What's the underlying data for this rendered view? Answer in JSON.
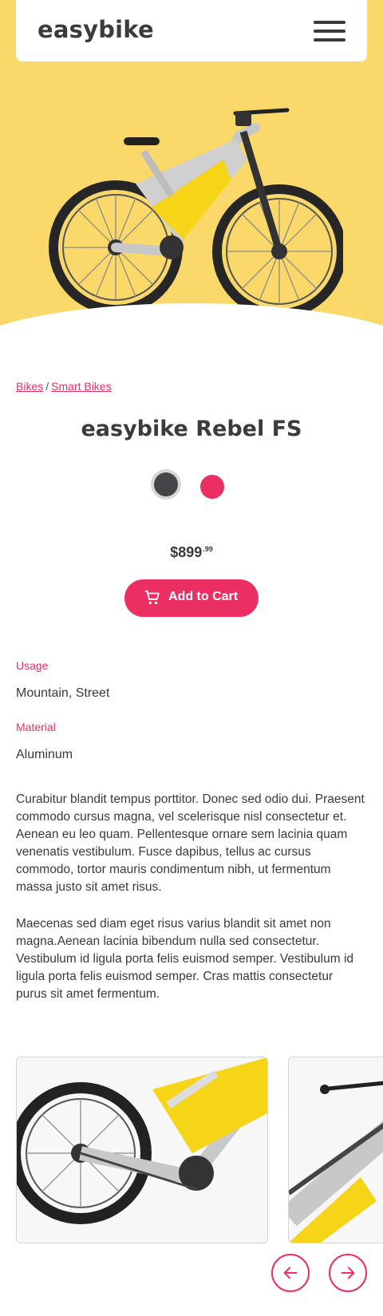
{
  "header": {
    "logo": "easybike",
    "menu_icon": "hamburger-menu-icon"
  },
  "hero": {
    "image": "electric mountain bike",
    "background_color": "#fad96a"
  },
  "breadcrumb": {
    "items": [
      "Bikes",
      "Smart Bikes"
    ],
    "separator": "/"
  },
  "product": {
    "title": "easybike Rebel FS",
    "colors": [
      {
        "name": "dark-gray",
        "hex": "#444449",
        "selected": true
      },
      {
        "name": "pink",
        "hex": "#ec2f62",
        "selected": false
      }
    ],
    "price_main": "$899",
    "price_cents": ".99",
    "add_to_cart": "Add to Cart",
    "cart_icon": "shopping-cart-icon"
  },
  "specs": [
    {
      "label": "Usage",
      "value": "Mountain, Street"
    },
    {
      "label": "Material",
      "value": "Aluminum"
    }
  ],
  "description": [
    "Curabitur blandit tempus porttitor. Donec sed odio dui. Praesent commodo cursus magna, vel scelerisque nisl consectetur et. Aenean eu leo quam. Pellentesque ornare sem lacinia quam venenatis vestibulum. Fusce dapibus, tellus ac cursus commodo, tortor mauris condimentum nibh, ut fermentum massa justo sit amet risus.",
    "Maecenas sed diam eget risus varius blandit sit amet non magna.Aenean lacinia bibendum nulla sed consectetur. Vestibulum id ligula porta felis euismod semper. Vestibulum id ligula porta felis euismod semper. Cras mattis consectetur purus sit amet fermentum."
  ],
  "gallery": {
    "images": [
      "bike rear wheel detail",
      "bike handlebar detail"
    ],
    "prev_icon": "arrow-left-icon",
    "next_icon": "arrow-right-icon"
  },
  "theme": {
    "accent": "#ec2f62",
    "text": "#3a3a3a"
  }
}
